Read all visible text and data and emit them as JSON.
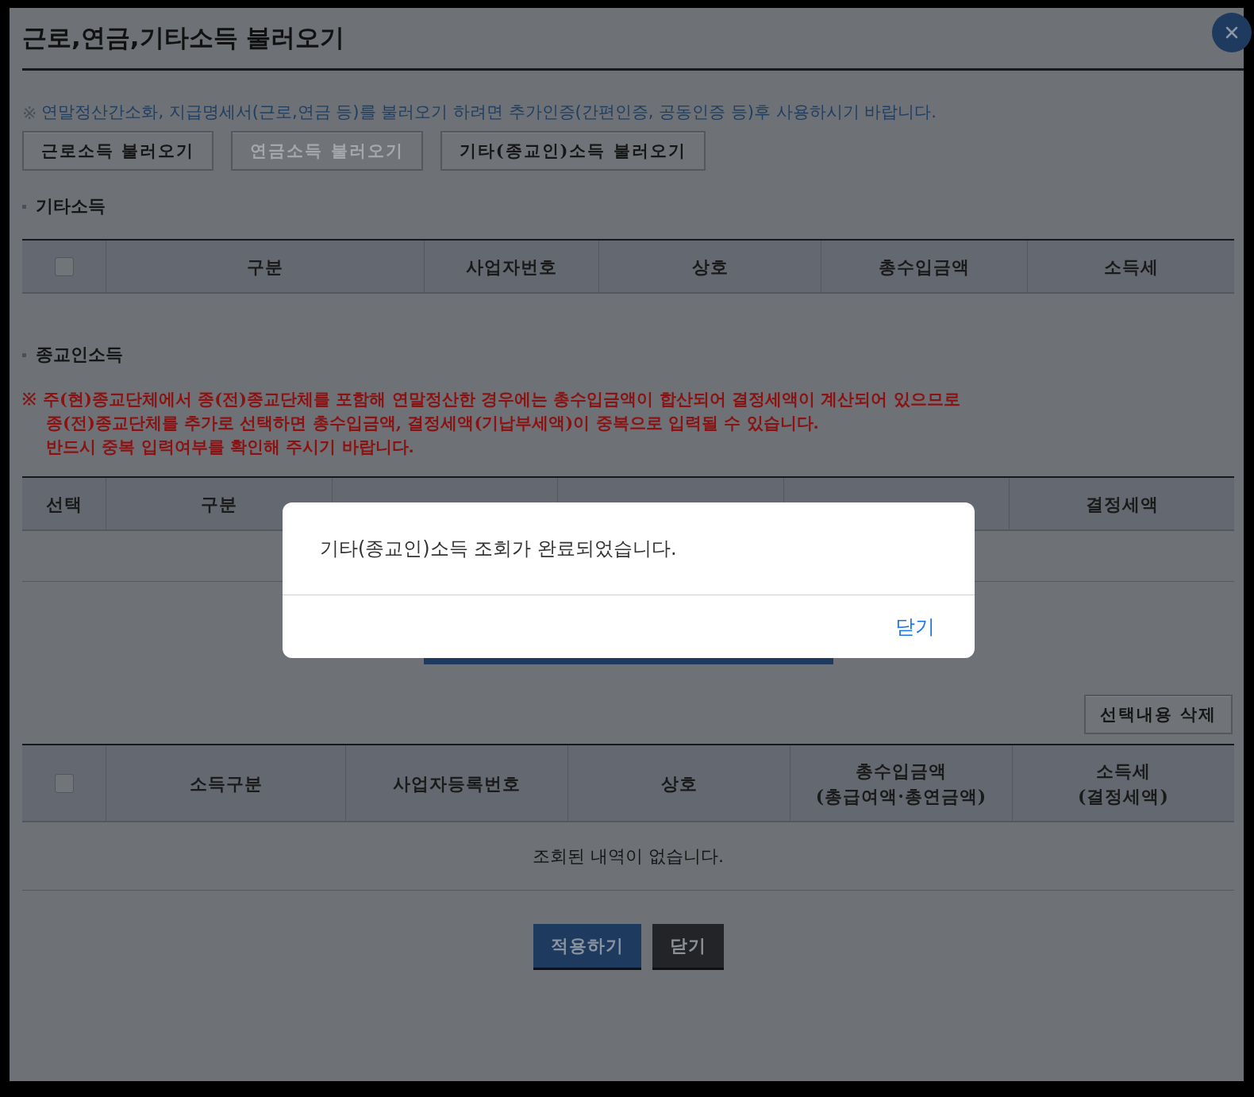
{
  "modal": {
    "title": "근로,연금,기타소득 불러오기"
  },
  "notice": {
    "mark": "※",
    "text": "연말정산간소화, 지급명세서(근로,연금 등)를 불러오기 하려면 추가인증(간편인증, 공동인증 등)후 사용하시기 바랍니다."
  },
  "load_buttons": [
    {
      "label": "근로소득 불러오기",
      "disabled": false
    },
    {
      "label": "연금소득 불러오기",
      "disabled": true
    },
    {
      "label": "기타(종교인)소득 불러오기",
      "disabled": false
    }
  ],
  "other_income": {
    "title": "기타소득",
    "header_checkbox": {
      "checked": false
    },
    "columns": [
      "구분",
      "사업자번호",
      "상호",
      "총수입금액",
      "소득세"
    ]
  },
  "religious_income": {
    "title": "종교인소득",
    "warning": {
      "mark": "※",
      "lines": [
        "주(현)종교단체에서 종(전)종교단체를 포함해 연말정산한 경우에는 총수입금액이 합산되어 결정세액이 계산되어 있으므로",
        "종(전)종교단체를 추가로 선택하면 총수입금액, 결정세액(기납부세액)이 중복으로 입력될 수 있습니다.",
        "반드시 중복 입력여부를 확인해 주시기 바랍니다."
      ]
    },
    "columns": [
      "선택",
      "구분",
      "결정세액"
    ]
  },
  "delete_button": "선택내용 삭제",
  "selected_table": {
    "header_checkbox": {
      "checked": false
    },
    "columns": [
      [
        "소득구분"
      ],
      [
        "사업자등록번호"
      ],
      [
        "상호"
      ],
      [
        "총수입금액",
        "(총급여액·총연금액)"
      ],
      [
        "소득세",
        "(결정세액)"
      ]
    ],
    "empty_message": "조회된 내역이 없습니다."
  },
  "footer_buttons": [
    {
      "label": "적용하기",
      "kind": "primary"
    },
    {
      "label": "닫기",
      "kind": "dark"
    }
  ],
  "alert": {
    "message": "기타(종교인)소득 조회가 완료되었습니다.",
    "button": "닫기"
  }
}
